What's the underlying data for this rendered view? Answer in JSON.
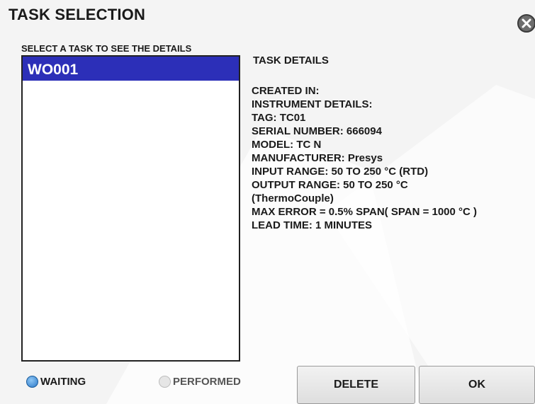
{
  "dialog": {
    "title": "TASK SELECTION"
  },
  "task_list": {
    "label": "SELECT A TASK TO SEE THE DETAILS",
    "items": [
      {
        "label": "WO001",
        "selected": true
      }
    ]
  },
  "details": {
    "title": "TASK DETAILS",
    "created_in": "CREATED IN:",
    "instrument_details": "INSTRUMENT DETAILS:",
    "tag": "TAG: TC01",
    "serial_number": "SERIAL NUMBER: 666094",
    "model": "MODEL: TC N",
    "manufacturer": "MANUFACTURER: Presys",
    "input_range": "INPUT RANGE: 50 TO 250 °C (RTD)",
    "output_range": "OUTPUT RANGE: 50 TO 250 °C",
    "output_type": "(ThermoCouple)",
    "max_error": "MAX ERROR = 0.5% SPAN( SPAN = 1000 °C )",
    "lead_time": "LEAD TIME: 1 MINUTES"
  },
  "filter": {
    "waiting": {
      "label": "WAITING",
      "selected": true
    },
    "performed": {
      "label": "PERFORMED",
      "selected": false
    }
  },
  "buttons": {
    "delete": "DELETE",
    "ok": "OK"
  },
  "icons": {
    "close": "close-icon"
  },
  "colors": {
    "selection": "#2c2fb8",
    "radio_on": "#2a78c8"
  }
}
